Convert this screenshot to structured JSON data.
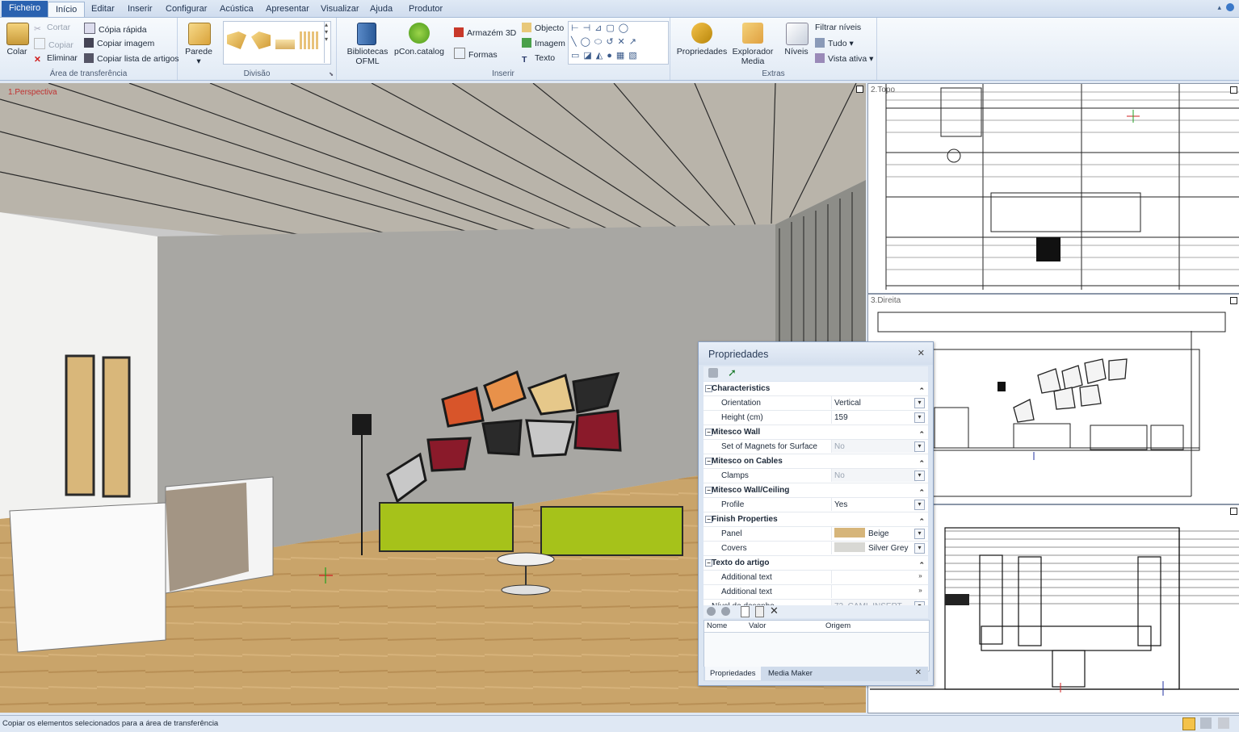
{
  "tabs": [
    "Ficheiro",
    "Início",
    "Editar",
    "Inserir",
    "Configurar",
    "Acústica",
    "Apresentar",
    "Visualizar",
    "Ajuda",
    "Produtor"
  ],
  "ribbon": {
    "clipboard": {
      "paste": "Colar",
      "cut": "Cortar",
      "copy": "Copiar",
      "delete": "Eliminar",
      "quick_copy": "Cópia rápida",
      "copy_image": "Copiar imagem",
      "copy_list": "Copiar lista de artigos",
      "label": "Área de transferência"
    },
    "division": {
      "wall": "Parede",
      "label": "Divisão"
    },
    "insert": {
      "libraries": "Bibliotecas\nOFML",
      "pcon": "pCon.catalog",
      "warehouse": "Armazém 3D",
      "shapes": "Formas",
      "object": "Objecto",
      "image": "Imagem",
      "text": "Texto",
      "label": "Inserir"
    },
    "extras": {
      "properties": "Propriedades",
      "explorer": "Explorador\nMedia",
      "levels": "Níveis",
      "filter": "Filtrar níveis",
      "all": "Tudo",
      "active_view": "Vista ativa",
      "label": "Extras"
    }
  },
  "viewports": {
    "main": "1.Perspectiva",
    "top": "2.Topo",
    "right": "3.Direita"
  },
  "properties": {
    "title": "Propriedades",
    "rows": [
      {
        "type": "cat",
        "name": "Characteristics"
      },
      {
        "type": "row",
        "name": "Orientation",
        "value": "Vertical",
        "dd": true
      },
      {
        "type": "row",
        "name": "Height (cm)",
        "value": "159",
        "dd": true
      },
      {
        "type": "cat",
        "name": "Mitesco Wall"
      },
      {
        "type": "row",
        "name": "Set of Magnets for Surface",
        "value": "No",
        "dd": true,
        "dis": true
      },
      {
        "type": "cat",
        "name": "Mitesco on Cables"
      },
      {
        "type": "row",
        "name": "Clamps",
        "value": "No",
        "dd": true,
        "dis": true
      },
      {
        "type": "cat",
        "name": "Mitesco Wall/Ceiling"
      },
      {
        "type": "row",
        "name": "Profile",
        "value": "Yes",
        "dd": true
      },
      {
        "type": "cat",
        "name": "Finish Properties"
      },
      {
        "type": "row",
        "name": "Panel",
        "value": "Beige",
        "dd": true,
        "swatch": "#d6b57a"
      },
      {
        "type": "row",
        "name": "Covers",
        "value": "Silver Grey",
        "dd": true,
        "swatch": "#d8d8d4"
      },
      {
        "type": "cat",
        "name": "Texto do artigo"
      },
      {
        "type": "row",
        "name": "Additional text",
        "value": "",
        "more": true
      },
      {
        "type": "row",
        "name": "Additional text",
        "value": "",
        "more": true
      },
      {
        "type": "plain",
        "name": "Nível de desenho",
        "value": "72_CAMI_INSERT",
        "dd": true,
        "dis": true
      }
    ],
    "columns": [
      "Nome",
      "Valor",
      "Origem"
    ],
    "bottom_tabs": [
      "Propriedades",
      "Media Maker"
    ]
  },
  "status": "Copiar os elementos selecionados para a área de transferência"
}
